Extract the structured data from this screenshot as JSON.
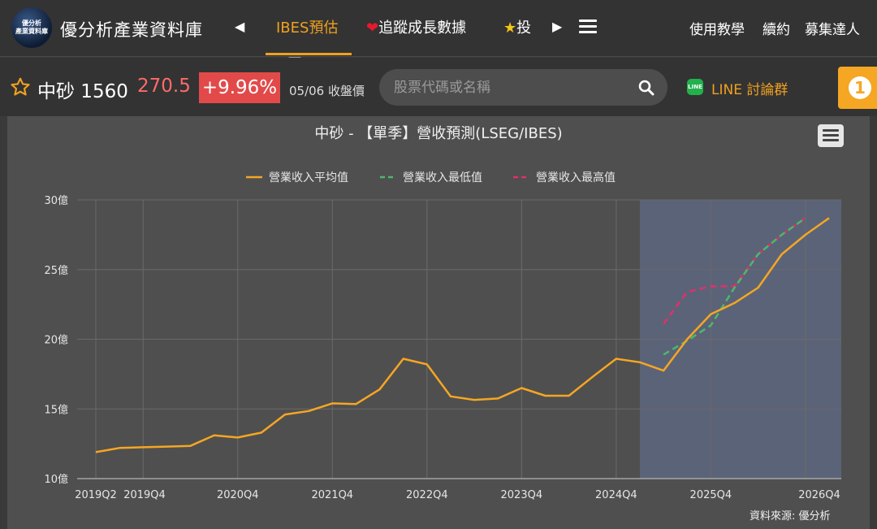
{
  "site": {
    "logo_lines": [
      "優分析",
      "產業資料庫"
    ],
    "title": "優分析產業資料庫"
  },
  "nav": {
    "tabs": [
      "IBES預估",
      "追蹤成長數據",
      "投"
    ],
    "active_tab": "IBES預估",
    "tab_icons": [
      "",
      "heart-icon",
      "star-icon"
    ],
    "right_links": [
      "使用教學",
      "續約",
      "募集達人"
    ]
  },
  "stock": {
    "name_code": "中砂 1560",
    "price": "270.5",
    "change": "+9.96%",
    "date_label": "05/06 收盤價"
  },
  "search": {
    "placeholder": "股票代碼或名稱"
  },
  "line_group": {
    "icon_text": "LINE",
    "label": "LINE 討論群"
  },
  "notification": {
    "count": "1"
  },
  "colors": {
    "accent": "#f0a020",
    "up": "#ff6a6a",
    "avg_line": "#f5a623",
    "low_line": "#4cb86b",
    "high_line": "#e0306a",
    "forecast_band": "#5b6378"
  },
  "chart_data": {
    "type": "line",
    "title": "中砂 - 【單季】營收預測(LSEG/IBES)",
    "source": "資料來源: 優分析",
    "y_unit": "億",
    "ylim": [
      10,
      30
    ],
    "y_ticks": [
      10,
      15,
      20,
      25,
      30
    ],
    "y_tick_labels": [
      "10億",
      "15億",
      "20億",
      "25億",
      "30億"
    ],
    "x_tick_labels": [
      "2019Q2",
      "2019Q4",
      "2020Q4",
      "2021Q4",
      "2022Q4",
      "2023Q4",
      "2024Q4",
      "2025Q4",
      "2026Q4"
    ],
    "legend_position": "top-center",
    "grid": true,
    "forecast_region": [
      "2025Q1",
      "2026Q4"
    ],
    "x": [
      "2019Q2",
      "2019Q3",
      "2019Q4",
      "2020Q1",
      "2020Q2",
      "2020Q3",
      "2020Q4",
      "2021Q1",
      "2021Q2",
      "2021Q3",
      "2021Q4",
      "2022Q1",
      "2022Q2",
      "2022Q3",
      "2022Q4",
      "2023Q1",
      "2023Q2",
      "2023Q3",
      "2023Q4",
      "2024Q1",
      "2024Q2",
      "2024Q3",
      "2024Q4",
      "2025Q1",
      "2025Q2",
      "2025Q3",
      "2025Q4",
      "2026Q1",
      "2026Q2",
      "2026Q3",
      "2026Q4"
    ],
    "series": [
      {
        "name": "營業收入平均值",
        "style": "solid",
        "values": [
          11.9,
          12.2,
          12.25,
          12.3,
          12.35,
          13.1,
          12.95,
          13.3,
          14.6,
          14.85,
          15.4,
          15.35,
          16.4,
          18.6,
          18.2,
          15.9,
          15.65,
          15.75,
          16.5,
          15.95,
          15.95,
          17.3,
          18.6,
          18.35,
          17.75,
          20.0,
          21.8,
          22.6,
          23.7,
          26.1,
          27.5,
          28.7
        ]
      },
      {
        "name": "營業收入最低值",
        "style": "dashed",
        "start_index": 24,
        "values": [
          18.9,
          19.9,
          21.0,
          23.7,
          26.1,
          27.5,
          28.7
        ]
      },
      {
        "name": "營業收入最高值",
        "style": "dashed",
        "start_index": 24,
        "values": [
          21.1,
          23.4,
          23.8,
          23.8,
          26.1,
          27.5,
          28.7
        ]
      }
    ]
  }
}
